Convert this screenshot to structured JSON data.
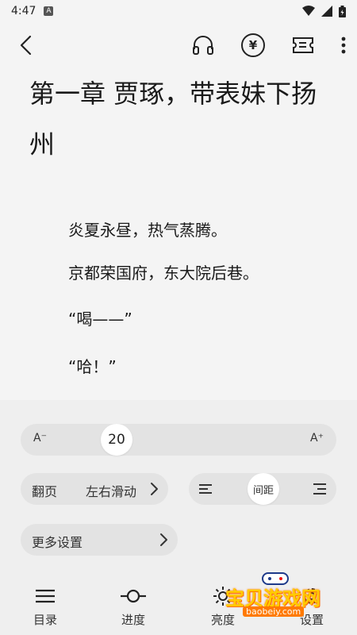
{
  "status": {
    "time": "4:47",
    "notification_glyph": "A"
  },
  "appbar": {
    "icons": [
      "back-arrow-icon",
      "headphones-icon",
      "yuan-coin-icon",
      "ticket-icon",
      "more-vertical-icon"
    ],
    "yuan_symbol": "¥"
  },
  "content": {
    "title": "第一章 贾琢，带表妹下扬州",
    "paragraphs": [
      "炎夏永昼，热气蒸腾。",
      "京都荣国府，东大院后巷。",
      "“喝——”",
      "“哈！”"
    ]
  },
  "settings": {
    "font": {
      "decrease_label": "A⁻",
      "increase_label": "A⁺",
      "size": "20"
    },
    "page_turn": {
      "label": "翻页",
      "value": "左右滑动"
    },
    "spacing": {
      "label": "间距"
    },
    "more": {
      "label": "更多设置"
    }
  },
  "nav": [
    {
      "label": "目录",
      "icon": "menu-icon"
    },
    {
      "label": "进度",
      "icon": "progress-icon"
    },
    {
      "label": "亮度",
      "icon": "brightness-icon"
    },
    {
      "label": "设置",
      "icon": "settings-icon"
    }
  ],
  "watermark": {
    "text": "宝贝游戏网",
    "url": "baobeiy.com"
  }
}
